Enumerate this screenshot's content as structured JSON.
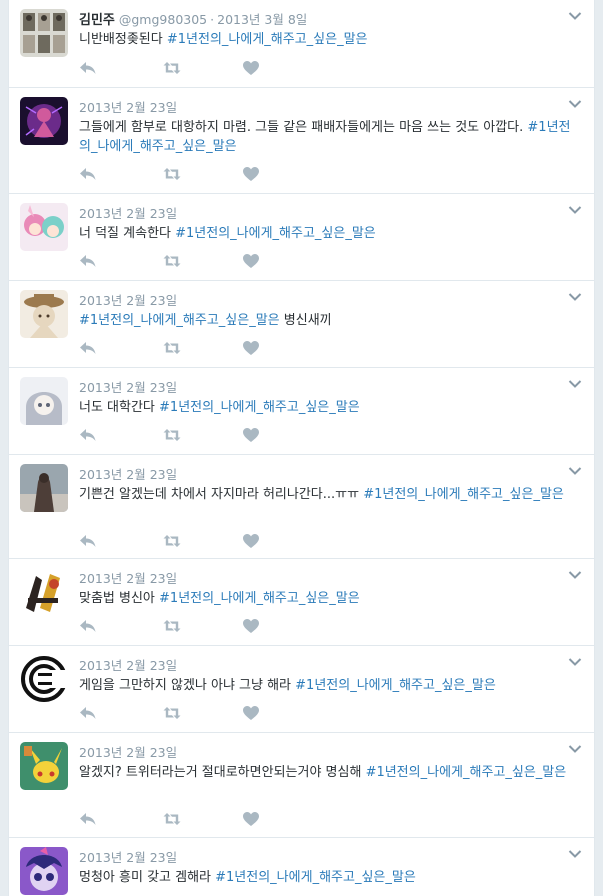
{
  "tweets": [
    {
      "name": "김민주",
      "handle": "@gmg980305",
      "time": "2013년 3월 8일",
      "text_pre": "니반배정좆된다 ",
      "hashtag": "#1년전의_나에게_해주고_싶은_말은",
      "text_post": "",
      "avatar_colors": [
        "#d9d9d2",
        "#6e6a5e",
        "#a7a093"
      ]
    },
    {
      "name": "",
      "handle": "",
      "time": "2013년 2월 23일",
      "text_pre": "그들에게 함부로 대항하지 마렴. 그들 같은 패배자들에게는 마음 쓰는 것도 아깝다. ",
      "hashtag": "#1년전의_나에게_해주고_싶은_말은",
      "text_post": "",
      "avatar_colors": [
        "#1a0f2e",
        "#6b2b8a",
        "#d05a9c"
      ]
    },
    {
      "name": "",
      "handle": "",
      "time": "2013년 2월 23일",
      "text_pre": "너 덕질 계속한다 ",
      "hashtag": "#1년전의_나에게_해주고_싶은_말은",
      "text_post": "",
      "avatar_colors": [
        "#f4eaf2",
        "#e98ab8",
        "#7bd0c9"
      ]
    },
    {
      "name": "",
      "handle": "",
      "time": "2013년 2월 23일",
      "text_pre": "",
      "hashtag": "#1년전의_나에게_해주고_싶은_말은",
      "text_post": " 병신새끼",
      "avatar_colors": [
        "#f2ece2",
        "#9c7a4e",
        "#e6d7bf"
      ]
    },
    {
      "name": "",
      "handle": "",
      "time": "2013년 2월 23일",
      "text_pre": "너도 대학간다 ",
      "hashtag": "#1년전의_나에게_해주고_싶은_말은",
      "text_post": "",
      "avatar_colors": [
        "#eef0f4",
        "#b7bcc8",
        "#5f6677"
      ]
    },
    {
      "name": "",
      "handle": "",
      "time": "2013년 2월 23일",
      "text_pre": "기쁜건 알겠는데 차에서 자지마라 허리나간다...ㅠㅠ ",
      "hashtag": "#1년전의_나에게_해주고_싶은_말은",
      "text_post": "",
      "avatar_colors": [
        "#9aa6ae",
        "#4d3e38",
        "#c9c4bd"
      ]
    },
    {
      "name": "",
      "handle": "",
      "time": "2013년 2월 23일",
      "text_pre": "맞춤법 병신아 ",
      "hashtag": "#1년전의_나에게_해주고_싶은_말은",
      "text_post": "",
      "avatar_colors": [
        "#ffffff",
        "#2b2320",
        "#d6a12a"
      ]
    },
    {
      "name": "",
      "handle": "",
      "time": "2013년 2월 23일",
      "text_pre": "게임을 그만하지 않겠나 아냐 그냥 해라 ",
      "hashtag": "#1년전의_나에게_해주고_싶은_말은",
      "text_post": "",
      "avatar_colors": [
        "#ffffff",
        "#111111",
        "#111111"
      ]
    },
    {
      "name": "",
      "handle": "",
      "time": "2013년 2월 23일",
      "text_pre": "알겠지? 트위터라는거 절대로하면안되는거야 명심해 ",
      "hashtag": "#1년전의_나에게_해주고_싶은_말은",
      "text_post": "",
      "avatar_colors": [
        "#3f8f6c",
        "#f3d23a",
        "#c9392d"
      ]
    },
    {
      "name": "",
      "handle": "",
      "time": "2013년 2월 23일",
      "text_pre": "멍청아 흥미 갖고 겜해라 ",
      "hashtag": "#1년전의_나에게_해주고_싶은_말은",
      "text_post": "",
      "avatar_colors": [
        "#8a58c9",
        "#e0d3f2",
        "#2d2a7a"
      ]
    }
  ],
  "icons": {
    "reply": "reply-icon",
    "retweet": "retweet-icon",
    "like": "heart-icon",
    "more": "chevron-down-icon"
  },
  "colors": {
    "hashtag": "#2b7bb9",
    "meta": "#8899a6",
    "action_icon": "#aab8c2"
  }
}
